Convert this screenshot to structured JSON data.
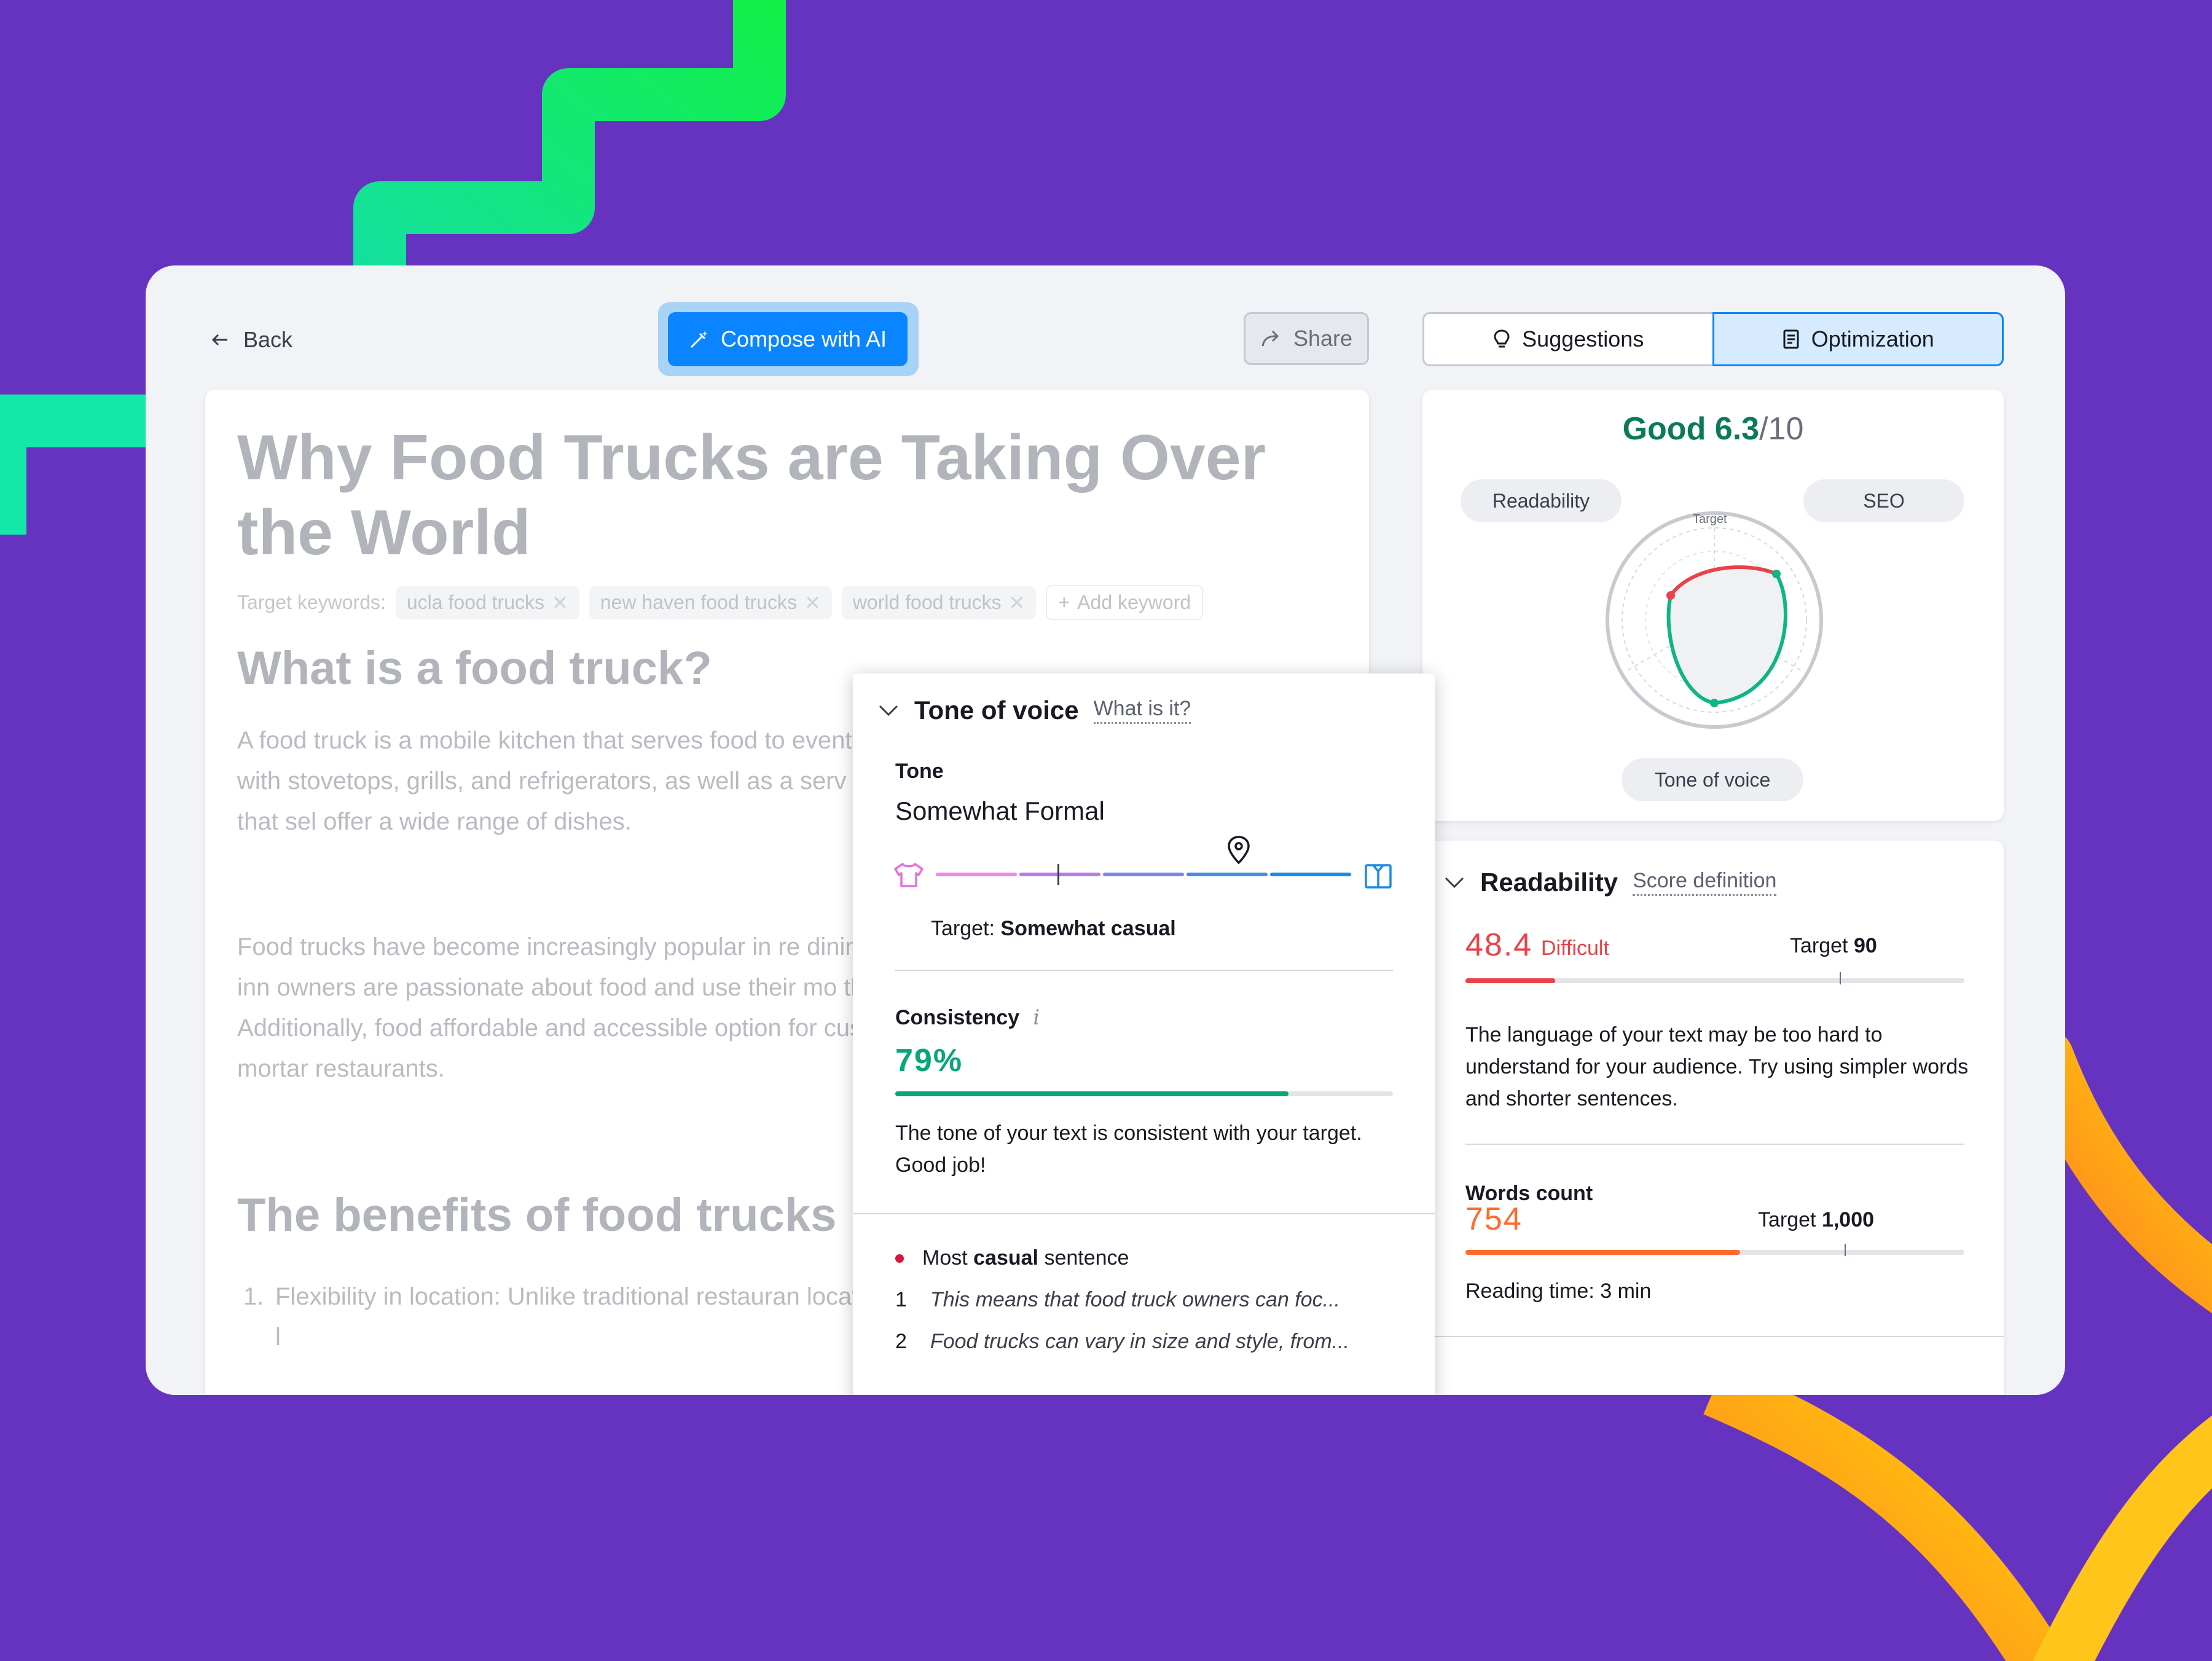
{
  "topbar": {
    "back_label": "Back",
    "compose_label": "Compose with AI",
    "share_label": "Share",
    "tabs": [
      {
        "label": "Suggestions",
        "active": false
      },
      {
        "label": "Optimization",
        "active": true
      }
    ]
  },
  "editor": {
    "title": "Why Food Trucks are Taking Over the World",
    "keywords_label": "Target keywords:",
    "keywords": [
      "ucla food trucks",
      "new haven food trucks",
      "world food trucks"
    ],
    "add_keyword": "Add keyword",
    "h2_1": "What is a food truck?",
    "p1": "A food truck is a mobile kitchen that serves food to events. These vehicles are typically equipped with stovetops, grills, and refrigerators, as well as a serv can vary in size and style, from small carts that sel offer a wide range of dishes.",
    "p2": "Food trucks have become increasingly popular in re dining experience and often serve creative and inn owners are passionate about food and use their mo their culinary skills and creativity. Additionally, food affordable and accessible option for customers, as costs as traditional brick-and-mortar restaurants.",
    "h2_2": "The benefits of food trucks",
    "list_num": "1.",
    "list_item": "Flexibility in location: Unlike traditional restauran location, food trucks can easily move from one l"
  },
  "tone": {
    "header": "Tone of voice",
    "what_link": "What is it?",
    "tone_label": "Tone",
    "tone_value": "Somewhat Formal",
    "slider_position": 0.73,
    "target_prefix": "Target:",
    "target_value": "Somewhat casual",
    "consistency_label": "Consistency",
    "consistency_info": "i",
    "consistency_value": "79%",
    "consistency_fraction": 0.79,
    "consistency_desc": "The tone of your text is consistent with your target. Good job!",
    "most_casual_prefix": "Most",
    "most_casual_bold": "casual",
    "most_casual_suffix": "sentence",
    "sentences": [
      {
        "num": "1",
        "text": "This means that food truck owners can foc..."
      },
      {
        "num": "2",
        "text": "Food trucks can vary in size and style, from..."
      }
    ]
  },
  "score": {
    "label": "Good",
    "value": "6.3",
    "denominator": "/10",
    "axes": [
      "Readability",
      "SEO",
      "Tone of voice"
    ],
    "target_label": "Target"
  },
  "readability": {
    "header": "Readability",
    "link": "Score definition",
    "score": "48.4",
    "level": "Difficult",
    "target_label": "Target",
    "target_value": "90",
    "score_fraction": 0.18,
    "target_fraction": 0.75,
    "desc": "The language of your text may be too hard to understand for your audience. Try using simpler words and shorter sentences.",
    "words_label": "Words count",
    "words_value": "754",
    "words_target_label": "Target",
    "words_target_value": "1,000",
    "words_fraction": 0.55,
    "words_target_fraction": 0.76,
    "reading_time": "Reading time: 3 min"
  },
  "colors": {
    "background": "#6633c0",
    "accent_blue": "#0a84ff",
    "good_green": "#0b7a5a",
    "consistency_green": "#0aa57a",
    "difficult_red": "#e8434a",
    "words_orange": "#ff6b2c"
  }
}
